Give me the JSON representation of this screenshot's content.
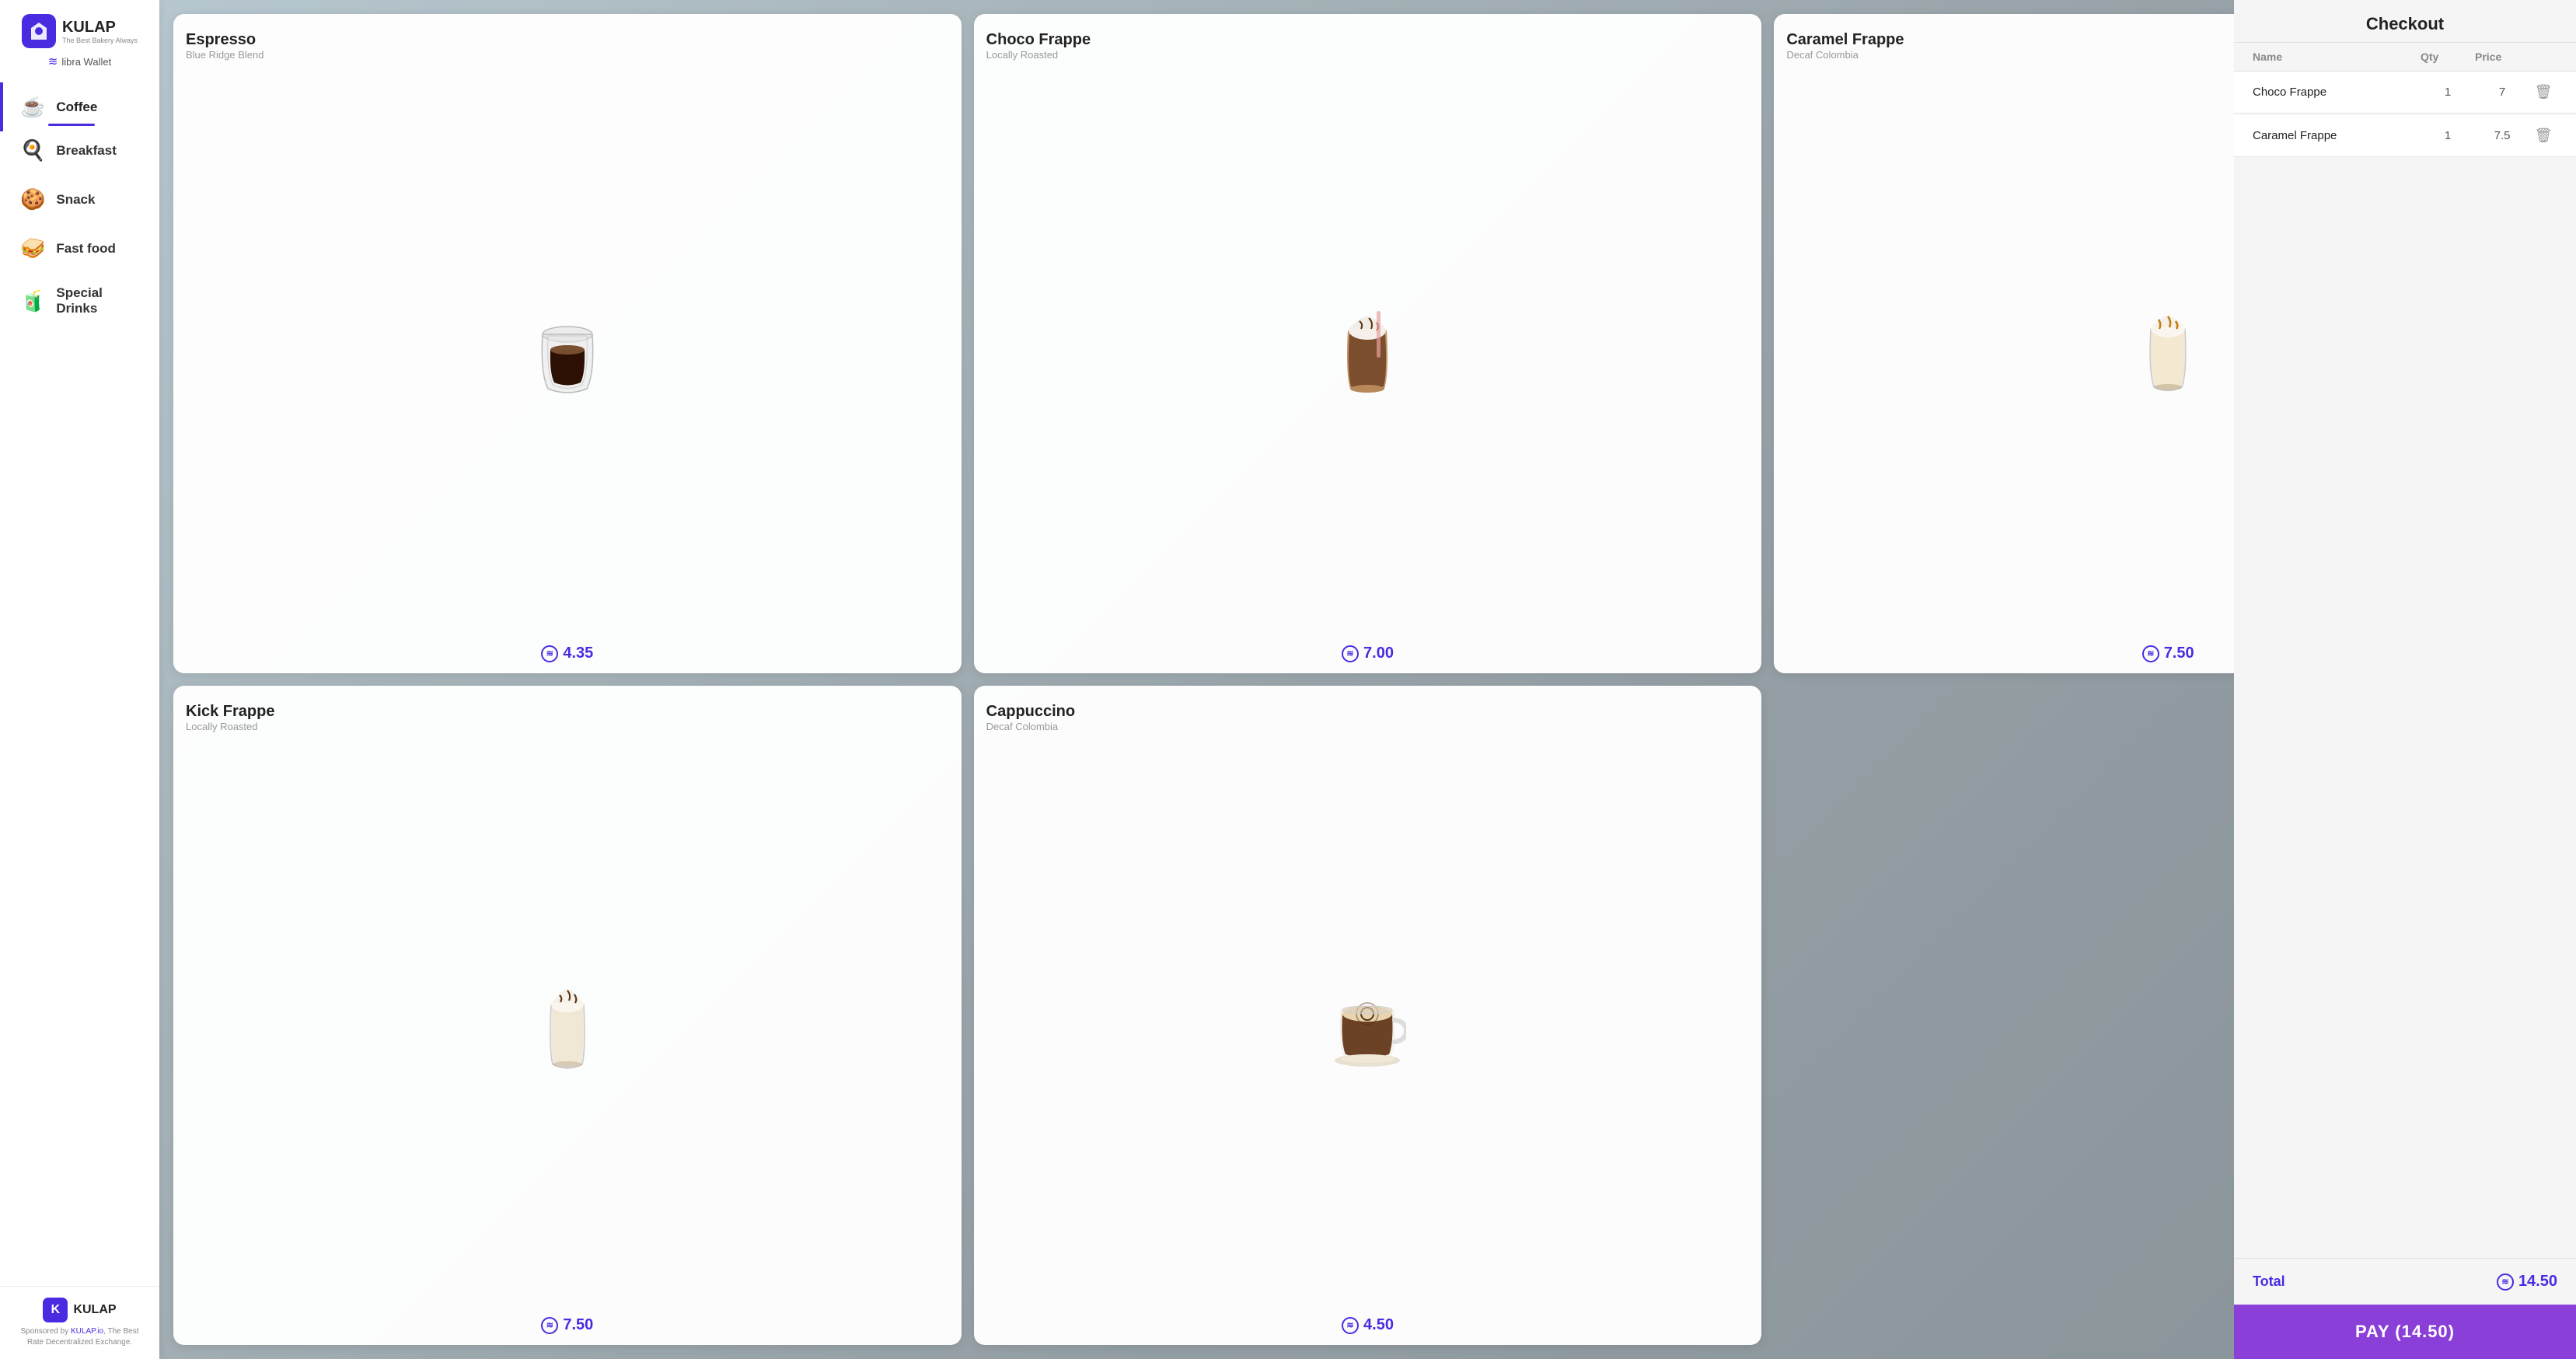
{
  "app": {
    "name": "KULAP",
    "tagline": "The Best Bakery Always",
    "wallet": "libra Wallet"
  },
  "sidebar": {
    "items": [
      {
        "id": "coffee",
        "label": "Coffee",
        "icon": "☕",
        "active": true
      },
      {
        "id": "breakfast",
        "label": "Breakfast",
        "icon": "🍳",
        "active": false
      },
      {
        "id": "snack",
        "label": "Snack",
        "icon": "🍪",
        "active": false
      },
      {
        "id": "fast-food",
        "label": "Fast food",
        "icon": "🥪",
        "active": false
      },
      {
        "id": "special-drinks",
        "label": "Special Drinks",
        "icon": "🧃",
        "active": false
      }
    ]
  },
  "footer": {
    "brand": "KULAP",
    "sponsored_text": "Sponsored by ",
    "sponsored_link": "KULAP.io",
    "sponsored_desc": ", The Best Rate Decentralized Exchange."
  },
  "products": [
    {
      "id": "espresso",
      "name": "Espresso",
      "subtitle": "Blue Ridge Blend",
      "price": "4.35",
      "icon": "☕"
    },
    {
      "id": "choco-frappe",
      "name": "Choco Frappe",
      "subtitle": "Locally Roasted",
      "price": "7.00",
      "icon": "🥤"
    },
    {
      "id": "caramel-frappe",
      "name": "Caramel Frappe",
      "subtitle": "Decaf Colombia",
      "price": "7.50",
      "icon": "🧋"
    },
    {
      "id": "kick-frappe",
      "name": "Kick Frappe",
      "subtitle": "Locally Roasted",
      "price": "7.50",
      "icon": "🥛"
    },
    {
      "id": "cappuccino",
      "name": "Cappuccino",
      "subtitle": "Decaf Colombia",
      "price": "4.50",
      "icon": "☕"
    }
  ],
  "checkout": {
    "title": "Checkout",
    "columns": {
      "name": "Name",
      "qty": "Qty",
      "price": "Price"
    },
    "items": [
      {
        "name": "Choco Frappe",
        "qty": "1",
        "price": "7"
      },
      {
        "name": "Caramel Frappe",
        "qty": "1",
        "price": "7.5"
      }
    ],
    "total_label": "Total",
    "total_amount": "14.50",
    "pay_label": "PAY (14.50)"
  }
}
